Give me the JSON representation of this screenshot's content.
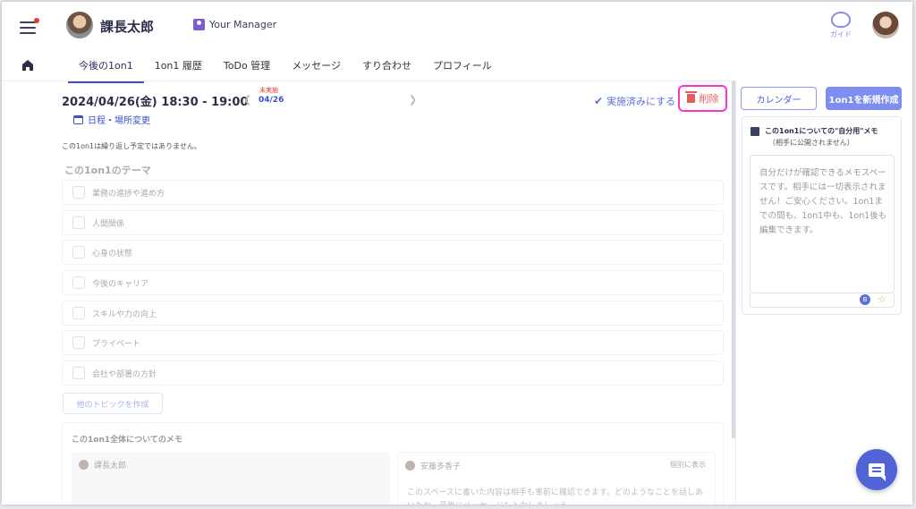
{
  "header": {
    "user_name": "課長太郎",
    "manager_badge": "Your Manager",
    "guide_label": "ガイド"
  },
  "tabs": [
    {
      "label": "今後の1on1",
      "active": true
    },
    {
      "label": "1on1 履歴",
      "active": false
    },
    {
      "label": "ToDo 管理",
      "active": false
    },
    {
      "label": "メッセージ",
      "active": false
    },
    {
      "label": "すり合わせ",
      "active": false
    },
    {
      "label": "プロフィール",
      "active": false
    }
  ],
  "meeting": {
    "datetime": "2024/04/26(金) 18:30 - 19:00",
    "nav_status": "未実施",
    "nav_date": "04/26",
    "mark_done_label": "実施済みにする",
    "delete_label": "削除",
    "schedule_change_label": "日程・場所変更",
    "repeat_note": "この1on1は繰り返し予定ではありません。"
  },
  "themes": {
    "title": "この1on1のテーマ",
    "items": [
      "業務の進捗や進め方",
      "人間関係",
      "心身の状態",
      "今後のキャリア",
      "スキルや力の向上",
      "プライベート",
      "会社や部署の方針"
    ],
    "add_other_label": "他のトピックを作成"
  },
  "memo": {
    "title": "この1on1全体についてのメモ",
    "left_author": "課長太郎",
    "right_author": "安藤多香子",
    "show_separately": "個別に表示",
    "right_placeholder": "このスペースに書いた内容は相手も事前に確認できます。どのようなことを話しあいたか、最後にメッセージも入力しましょう"
  },
  "right_panel": {
    "calendar_label": "カレンダー",
    "new_label": "1on1を新規作成",
    "private_title": "この1on1についての\"自分用\"メモ",
    "private_subtitle": "（相手に公開されません）",
    "private_placeholder": "自分だけが確認できるメモスペースです。相手には一切表示されません！ご安心ください。1on1までの間も、1on1中も、1on1後も編集できます。",
    "coin_label": "B"
  },
  "colors": {
    "accent": "#3b4fcf",
    "primary_button": "#7e8df0",
    "delete_text": "#e25d5d",
    "highlight_border": "#ff33cc",
    "status_red": "#e53935"
  },
  "icons": [
    "menu-icon",
    "home-icon",
    "guide-icon",
    "check-icon",
    "trash-icon",
    "calendar-icon",
    "memo-icon",
    "star-icon",
    "chat-icon"
  ]
}
